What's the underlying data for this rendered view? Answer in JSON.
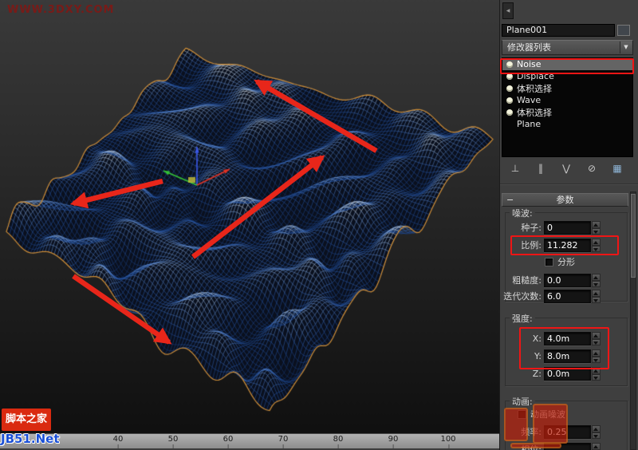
{
  "annotations": {
    "arrow_color": "#e8261a",
    "box_color": "#ef1515"
  },
  "watermarks": {
    "site": "WWW.3DXY.COM"
  },
  "branding": {
    "logo_text": "脚本之家",
    "logo_site": "JB51.Net"
  },
  "viewport": {
    "colors": {
      "bg_top": "#3a3a3a",
      "bg_bottom": "#101010",
      "mesh_fill": "#0a101e",
      "mesh_deep": "#0e2a5c",
      "mesh_mid": "#2656a8",
      "mesh_light": "#6c96d4",
      "mesh_pale": "#c6daf0",
      "mesh_crest": "#ffffff",
      "selection_border": "#cf8b2f",
      "gizmo_x": "#e03224",
      "gizmo_y": "#35c135",
      "gizmo_z": "#3a57e8",
      "gizmo_center": "#c8c23c"
    }
  },
  "timeline": {
    "ticks": [
      "40",
      "50",
      "60",
      "70",
      "80",
      "90",
      "100"
    ]
  },
  "panel": {
    "top_tab_icon": "◀",
    "dropdown_arrow": "▼",
    "object_name": "Plane001",
    "modifier_list_label": "修改器列表",
    "stack": {
      "items": [
        {
          "label": "Noise"
        },
        {
          "label": "Displace"
        },
        {
          "label": "体积选择"
        },
        {
          "label": "Wave"
        },
        {
          "label": "体积选择"
        },
        {
          "label": "Plane"
        }
      ]
    },
    "stack_toolbar": {
      "pin": "⊥",
      "show_end_result": "‖",
      "make_unique": "⋁",
      "remove": "⊘",
      "configure": "▦"
    },
    "rollout": {
      "collapse": "−",
      "title": "参数"
    },
    "noise_group": {
      "label": "噪波:",
      "seed_label": "种子:",
      "seed_value": "0",
      "scale_label": "比例:",
      "scale_value": "11.282",
      "fractal_label": "分形",
      "roughness_label": "粗糙度:",
      "roughness_value": "0.0",
      "iterations_label": "迭代次数:",
      "iterations_value": "6.0"
    },
    "strength_group": {
      "label": "强度:",
      "x_label": "X:",
      "x_value": "4.0m",
      "y_label": "Y:",
      "y_value": "8.0m",
      "z_label": "Z:",
      "z_value": "0.0m"
    },
    "animation_group": {
      "label": "动画:",
      "animate_label": "动画噪波",
      "frequency_label": "频率:",
      "frequency_value": "0.25",
      "phase_label": "相位:",
      "phase_value": ""
    }
  }
}
